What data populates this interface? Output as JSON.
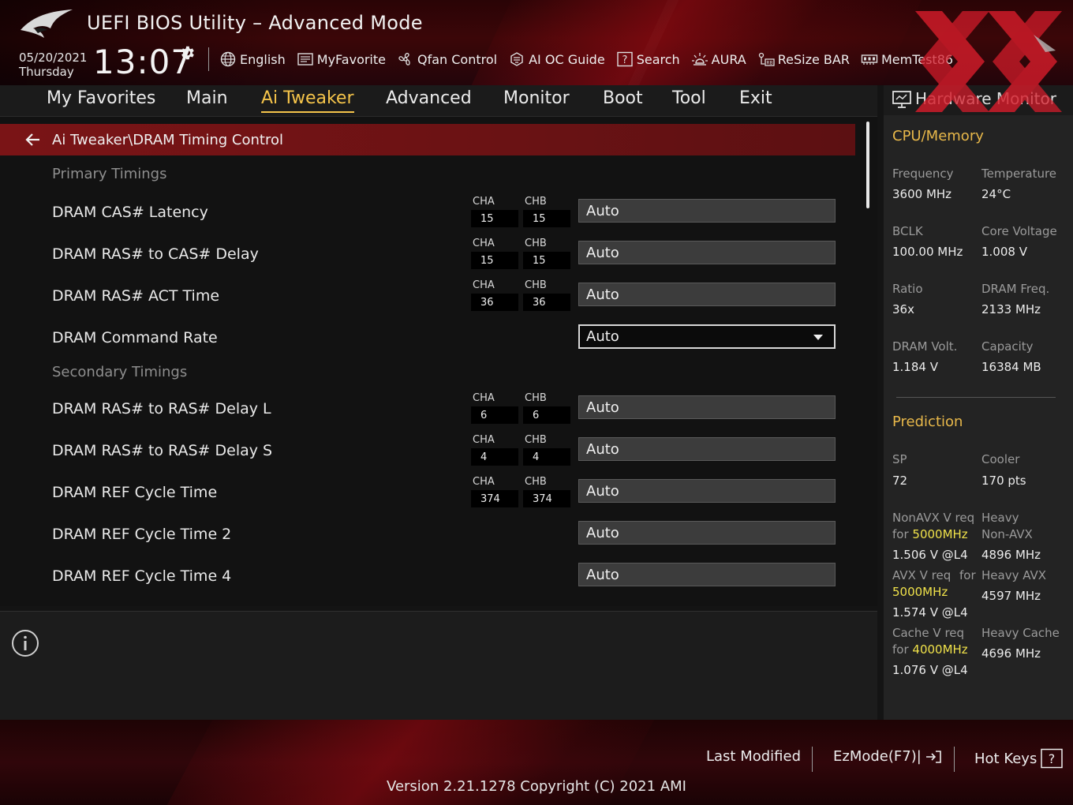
{
  "header": {
    "title": "UEFI BIOS Utility – Advanced Mode",
    "date": "05/20/2021",
    "day": "Thursday",
    "time": "13:07",
    "toolbar": [
      {
        "label": "English",
        "icon": "globe-icon"
      },
      {
        "label": "MyFavorite",
        "icon": "favorite-icon"
      },
      {
        "label": "Qfan Control",
        "icon": "fan-icon"
      },
      {
        "label": "AI OC Guide",
        "icon": "oc-guide-icon"
      },
      {
        "label": "Search",
        "icon": "search-icon"
      },
      {
        "label": "AURA",
        "icon": "aura-icon"
      },
      {
        "label": "ReSize BAR",
        "icon": "resize-bar-icon"
      },
      {
        "label": "MemTest86",
        "icon": "memtest-icon"
      }
    ]
  },
  "tabs": [
    {
      "label": "My Favorites",
      "active": false
    },
    {
      "label": "Main",
      "active": false
    },
    {
      "label": "Ai Tweaker",
      "active": true
    },
    {
      "label": "Advanced",
      "active": false
    },
    {
      "label": "Monitor",
      "active": false
    },
    {
      "label": "Boot",
      "active": false
    },
    {
      "label": "Tool",
      "active": false
    },
    {
      "label": "Exit",
      "active": false
    }
  ],
  "breadcrumb": "Ai Tweaker\\DRAM Timing Control",
  "sections": {
    "primary": "Primary Timings",
    "secondary": "Secondary Timings"
  },
  "channel_labels": {
    "a": "CHA",
    "b": "CHB"
  },
  "settings": [
    {
      "label": "DRAM CAS# Latency",
      "cha": "15",
      "chb": "15",
      "value": "Auto",
      "kind": "input"
    },
    {
      "label": "DRAM RAS# to CAS# Delay",
      "cha": "15",
      "chb": "15",
      "value": "Auto",
      "kind": "input"
    },
    {
      "label": "DRAM RAS# ACT Time",
      "cha": "36",
      "chb": "36",
      "value": "Auto",
      "kind": "input"
    },
    {
      "label": "DRAM Command Rate",
      "value": "Auto",
      "kind": "select"
    },
    {
      "label": "DRAM RAS# to RAS# Delay L",
      "cha": "6",
      "chb": "6",
      "value": "Auto",
      "kind": "input"
    },
    {
      "label": "DRAM RAS# to RAS# Delay S",
      "cha": "4",
      "chb": "4",
      "value": "Auto",
      "kind": "input"
    },
    {
      "label": "DRAM REF Cycle Time",
      "cha": "374",
      "chb": "374",
      "value": "Auto",
      "kind": "input"
    },
    {
      "label": "DRAM REF Cycle Time 2",
      "value": "Auto",
      "kind": "input"
    },
    {
      "label": "DRAM REF Cycle Time 4",
      "value": "Auto",
      "kind": "input"
    }
  ],
  "hardware_monitor": {
    "title": "Hardware Monitor",
    "cpu_memory": {
      "title": "CPU/Memory",
      "frequency_label": "Frequency",
      "frequency": "3600 MHz",
      "temperature_label": "Temperature",
      "temperature": "24°C",
      "bclk_label": "BCLK",
      "bclk": "100.00 MHz",
      "core_voltage_label": "Core Voltage",
      "core_voltage": "1.008 V",
      "ratio_label": "Ratio",
      "ratio": "36x",
      "dram_freq_label": "DRAM Freq.",
      "dram_freq": "2133 MHz",
      "dram_volt_label": "DRAM Volt.",
      "dram_volt": "1.184 V",
      "capacity_label": "Capacity",
      "capacity": "16384 MB"
    },
    "prediction": {
      "title": "Prediction",
      "sp_label": "SP",
      "sp": "72",
      "cooler_label": "Cooler",
      "cooler": "170 pts",
      "nonavx_label_1": "NonAVX V req",
      "nonavx_for": "for",
      "nonavx_freq": "5000MHz",
      "nonavx_value": "1.506 V @L4",
      "heavy_nonavx_label_1": "Heavy",
      "heavy_nonavx_label_2": "Non-AVX",
      "heavy_nonavx_value": "4896 MHz",
      "avx_label": "AVX V req",
      "avx_for": "for",
      "avx_freq": "5000MHz",
      "avx_value": "1.574 V @L4",
      "heavy_avx_label": "Heavy AVX",
      "heavy_avx_value": "4597 MHz",
      "cache_label": "Cache V req",
      "cache_for": "for",
      "cache_freq": "4000MHz",
      "cache_value": "1.076 V @L4",
      "heavy_cache_label": "Heavy Cache",
      "heavy_cache_value": "4696 MHz"
    }
  },
  "footer": {
    "last_modified": "Last Modified",
    "ezmode": "EzMode(F7)|",
    "hot_keys": "Hot Keys",
    "version": "Version 2.21.1278 Copyright (C) 2021 AMI"
  },
  "colors": {
    "accent": "#f5c44a",
    "breadcrumb": "#7a1416",
    "highlight": "#f0e24a"
  }
}
